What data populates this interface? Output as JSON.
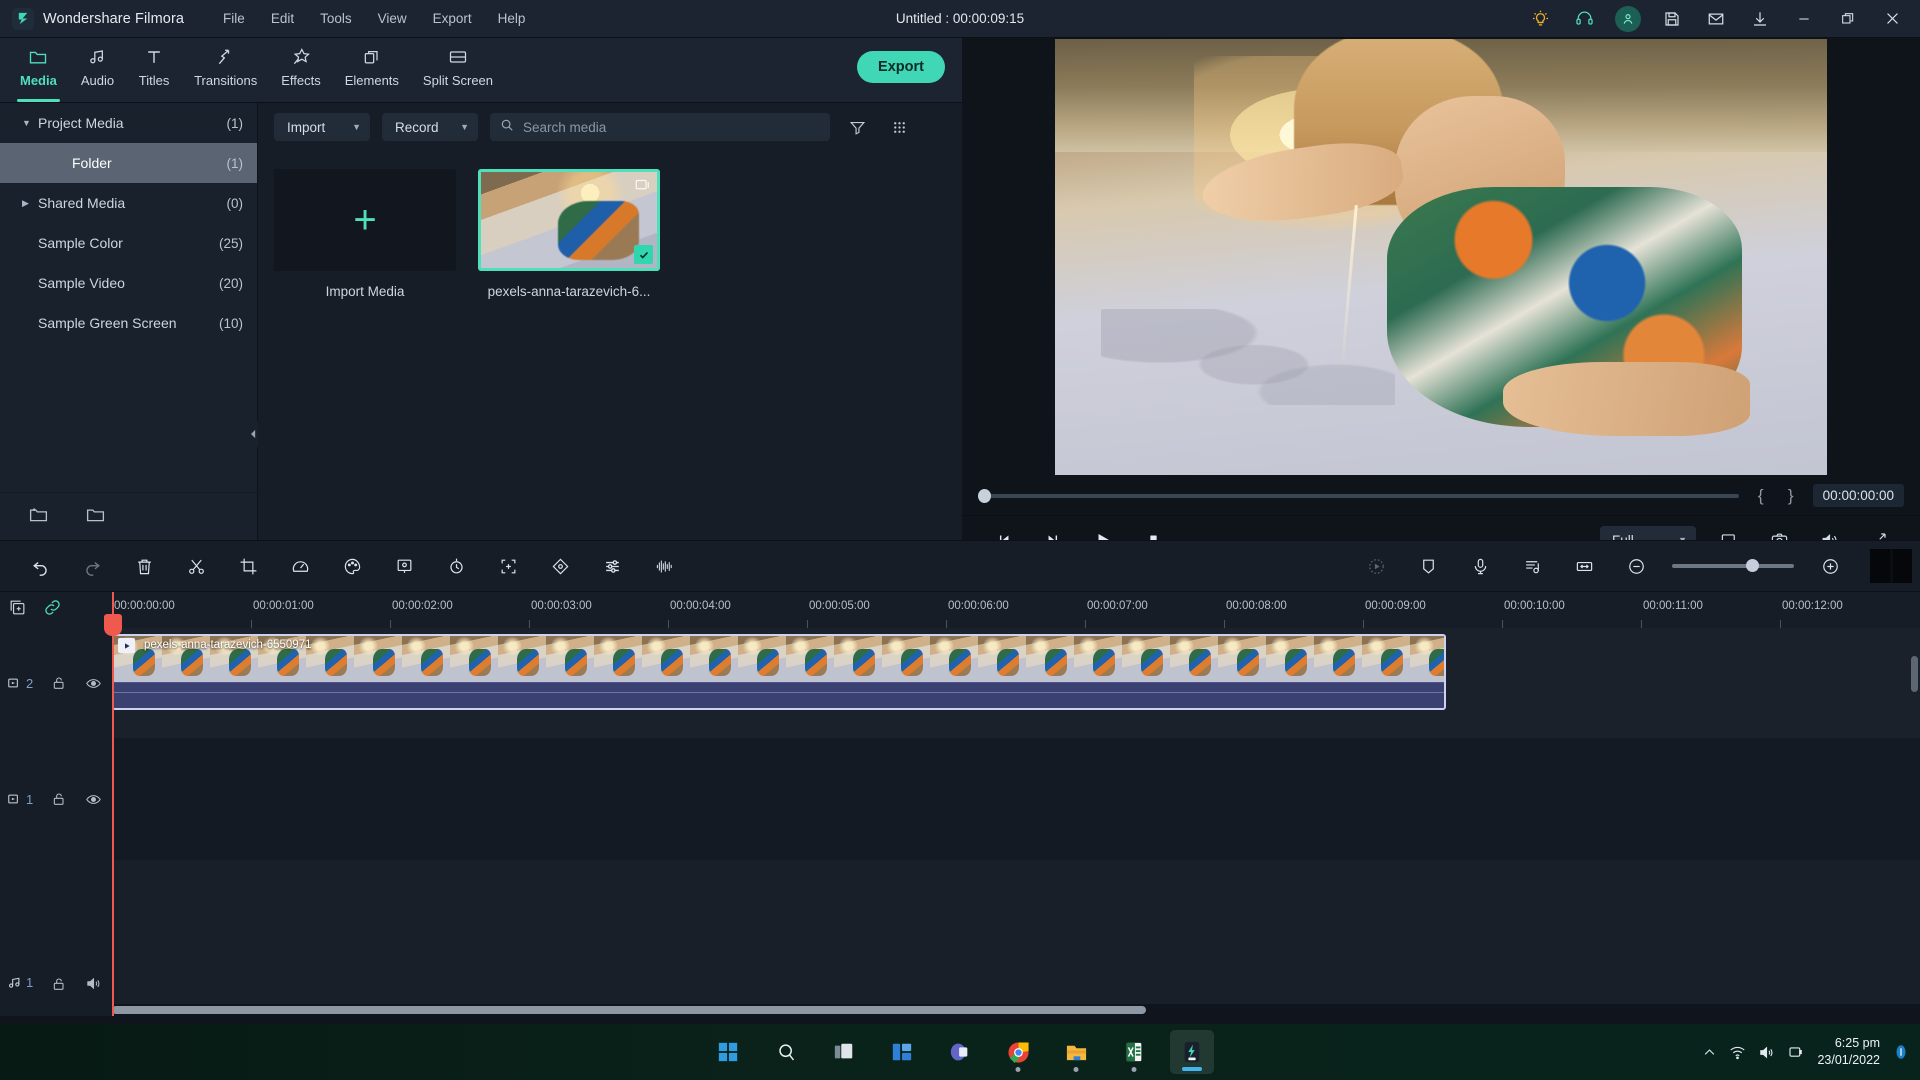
{
  "app": {
    "brand": "Wondershare Filmora",
    "logo_icon": "filmora-logo-icon",
    "project_title": "Untitled : 00:00:09:15"
  },
  "menubar": {
    "items": [
      {
        "label": "File"
      },
      {
        "label": "Edit"
      },
      {
        "label": "Tools"
      },
      {
        "label": "View"
      },
      {
        "label": "Export"
      },
      {
        "label": "Help"
      }
    ]
  },
  "titlebar_icons": [
    {
      "name": "tips-bulb-icon",
      "color": "#f0b429"
    },
    {
      "name": "headset-support-icon",
      "color": "#4fe0bb"
    },
    {
      "name": "account-avatar-icon",
      "color": "#4fe0bb"
    },
    {
      "name": "save-icon",
      "color": "#d8e0e8"
    },
    {
      "name": "mail-icon",
      "color": "#d8e0e8"
    },
    {
      "name": "download-icon",
      "color": "#d8e0e8"
    },
    {
      "name": "minimize-icon",
      "color": "#d8e0e8"
    },
    {
      "name": "restore-icon",
      "color": "#d8e0e8"
    },
    {
      "name": "close-icon",
      "color": "#d8e0e8"
    }
  ],
  "modebar": {
    "tabs": [
      {
        "label": "Media",
        "icon": "folder-icon",
        "active": true
      },
      {
        "label": "Audio",
        "icon": "music-note-icon",
        "active": false
      },
      {
        "label": "Titles",
        "icon": "text-t-icon",
        "active": false
      },
      {
        "label": "Transitions",
        "icon": "transition-arrows-icon",
        "active": false
      },
      {
        "label": "Effects",
        "icon": "effects-star-icon",
        "active": false
      },
      {
        "label": "Elements",
        "icon": "elements-layers-icon",
        "active": false
      },
      {
        "label": "Split Screen",
        "icon": "split-screen-icon",
        "active": false
      }
    ],
    "export_label": "Export",
    "export_color": "#3fd7b6"
  },
  "sidebar": {
    "items": [
      {
        "label": "Project Media",
        "count": "(1)",
        "caret": "down",
        "indent": false,
        "selected": false
      },
      {
        "label": "Folder",
        "count": "(1)",
        "caret": "none",
        "indent": true,
        "selected": true
      },
      {
        "label": "Shared Media",
        "count": "(0)",
        "caret": "right",
        "indent": false,
        "selected": false
      },
      {
        "label": "Sample Color",
        "count": "(25)",
        "caret": "none",
        "indent": false,
        "selected": false
      },
      {
        "label": "Sample Video",
        "count": "(20)",
        "caret": "none",
        "indent": false,
        "selected": false
      },
      {
        "label": "Sample Green Screen",
        "count": "(10)",
        "caret": "none",
        "indent": false,
        "selected": false
      }
    ],
    "footer_icons": [
      {
        "name": "new-folder-icon"
      },
      {
        "name": "open-folder-icon"
      }
    ],
    "collapse_icon": "collapse-panel-icon"
  },
  "media_panel": {
    "import_button": "Import",
    "record_button": "Record",
    "search_placeholder": "Search media",
    "search_value": "",
    "search_icon": "search-icon",
    "filter_icon": "filter-icon",
    "grid_view_icon": "grid-view-icon",
    "items": [
      {
        "caption": "Import Media",
        "type": "import-placeholder",
        "selected": false
      },
      {
        "caption": "pexels-anna-tarazevich-6...",
        "type": "video-thumbnail",
        "selected": true
      }
    ]
  },
  "preview": {
    "scrub_position_pct": 0,
    "mark_in_label": "{",
    "mark_out_label": "}",
    "timecode": "00:00:00:00",
    "controls": [
      {
        "name": "prev-frame-button",
        "icon": "step-backward-icon"
      },
      {
        "name": "next-frame-button",
        "icon": "step-forward-icon"
      },
      {
        "name": "play-button",
        "icon": "play-icon"
      },
      {
        "name": "stop-button",
        "icon": "stop-icon"
      }
    ],
    "quality_label": "Full",
    "right_icons": [
      {
        "name": "project-settings-icon"
      },
      {
        "name": "snapshot-camera-icon"
      },
      {
        "name": "volume-icon"
      },
      {
        "name": "fullscreen-icon"
      }
    ]
  },
  "timeline_toolbar": {
    "left_icons": [
      {
        "name": "undo-icon"
      },
      {
        "name": "redo-icon"
      },
      {
        "name": "delete-icon"
      },
      {
        "name": "split-scissors-icon"
      },
      {
        "name": "crop-icon"
      },
      {
        "name": "speed-icon"
      },
      {
        "name": "color-palette-icon"
      },
      {
        "name": "green-screen-icon"
      },
      {
        "name": "motion-tracking-icon"
      },
      {
        "name": "auto-reframe-icon"
      },
      {
        "name": "keyframe-icon"
      },
      {
        "name": "adjust-sliders-icon"
      },
      {
        "name": "audio-equalizer-icon"
      }
    ],
    "right_icons": [
      {
        "name": "auto-beat-sync-icon"
      },
      {
        "name": "marker-icon"
      },
      {
        "name": "voiceover-mic-icon"
      },
      {
        "name": "audio-mixer-icon"
      },
      {
        "name": "fit-timeline-icon"
      },
      {
        "name": "zoom-out-icon"
      },
      {
        "name": "zoom-in-icon"
      }
    ],
    "zoom_value_pct": 61,
    "render_preview_icon": "render-preview-icon"
  },
  "timeline": {
    "head_icons": [
      {
        "name": "add-track-icon"
      },
      {
        "name": "link-clips-icon"
      }
    ],
    "ruler_ticks": [
      "00:00:00:00",
      "00:00:01:00",
      "00:00:02:00",
      "00:00:03:00",
      "00:00:04:00",
      "00:00:05:00",
      "00:00:06:00",
      "00:00:07:00",
      "00:00:08:00",
      "00:00:09:00",
      "00:00:10:00",
      "00:00:11:00",
      "00:00:12:00"
    ],
    "playhead_time": "00:00:00:00",
    "tracks": [
      {
        "type": "video",
        "number": "2",
        "track_icon": "video-track-icon",
        "lock_icon": "unlocked-icon",
        "visibility_icon": "eye-visible-icon",
        "clip": {
          "label": "pexels-anna-tarazevich-6550971",
          "play_badge_icon": "clip-play-icon"
        }
      },
      {
        "type": "video",
        "number": "1",
        "track_icon": "video-track-icon",
        "lock_icon": "unlocked-icon",
        "visibility_icon": "eye-visible-icon",
        "clip": null
      },
      {
        "type": "audio",
        "number": "1",
        "track_icon": "audio-track-icon",
        "lock_icon": "unlocked-icon",
        "visibility_icon": "speaker-on-icon",
        "clip": null
      }
    ]
  },
  "taskbar": {
    "apps": [
      {
        "name": "windows-start-icon",
        "running": false,
        "active": false
      },
      {
        "name": "search-icon",
        "running": false,
        "active": false
      },
      {
        "name": "task-view-icon",
        "running": false,
        "active": false
      },
      {
        "name": "widgets-icon",
        "running": false,
        "active": false
      },
      {
        "name": "microsoft-teams-icon",
        "running": false,
        "active": false
      },
      {
        "name": "google-chrome-icon",
        "running": true,
        "active": false
      },
      {
        "name": "file-explorer-icon",
        "running": true,
        "active": false
      },
      {
        "name": "microsoft-excel-icon",
        "running": true,
        "active": false
      },
      {
        "name": "wondershare-filmora-icon",
        "running": true,
        "active": true
      }
    ],
    "tray": [
      {
        "name": "show-hidden-icons-icon"
      },
      {
        "name": "wifi-icon"
      },
      {
        "name": "volume-icon"
      },
      {
        "name": "battery-icon"
      }
    ],
    "time": "6:25 pm",
    "date": "23/01/2022",
    "notification_icon": "notification-bell-icon"
  }
}
